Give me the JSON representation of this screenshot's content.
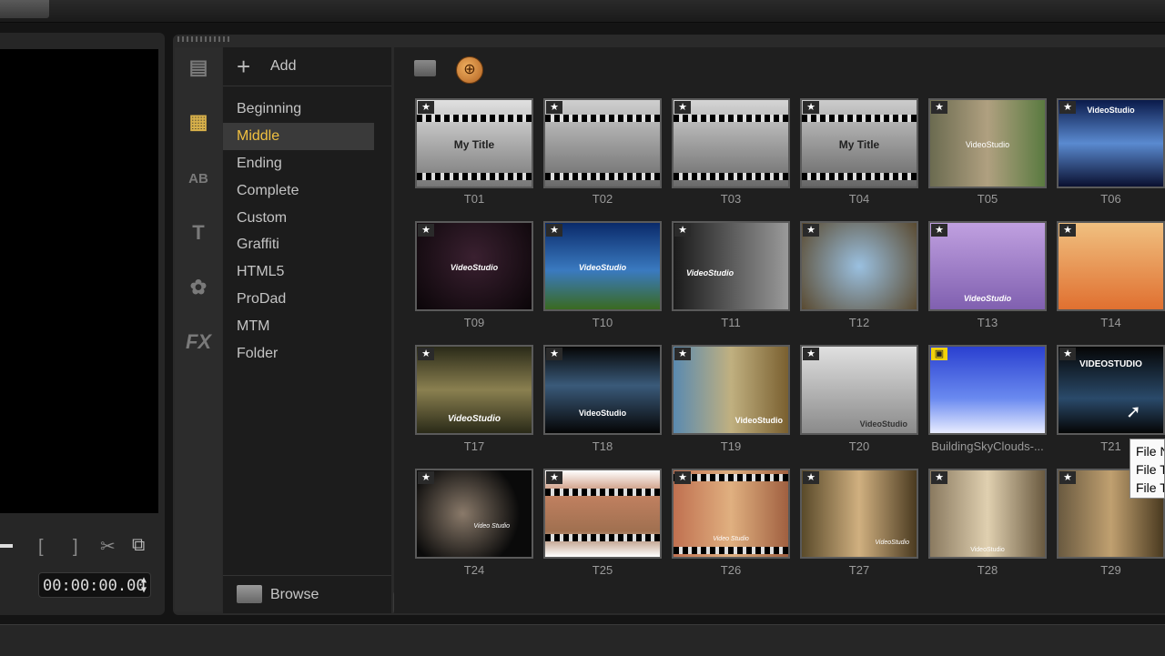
{
  "library": {
    "add_label": "Add",
    "browse_label": "Browse",
    "collapse_glyph": "«",
    "categories": [
      "Beginning",
      "Middle",
      "Ending",
      "Complete",
      "Custom",
      "Graffiti",
      "HTML5",
      "ProDad",
      "MTM",
      "Folder"
    ],
    "selected_category": "Middle",
    "side_icons": [
      "media-icon",
      "instant-project-icon",
      "transition-icon",
      "title-icon",
      "graphic-icon",
      "filter-icon"
    ],
    "side_icon_labels": {
      "transition": "AB",
      "title": "T",
      "filter": "FX"
    }
  },
  "player": {
    "timecode": "00:00:00.00",
    "bracket_in": "[",
    "bracket_out": "]"
  },
  "thumbnails": [
    {
      "caption": "T01",
      "overlay": "My Title"
    },
    {
      "caption": "T02",
      "overlay": ""
    },
    {
      "caption": "T03",
      "overlay": ""
    },
    {
      "caption": "T04",
      "overlay": "My Title"
    },
    {
      "caption": "T05",
      "overlay": "VideoStudio"
    },
    {
      "caption": "T06",
      "overlay": "VideoStudio"
    },
    {
      "caption": "T09",
      "overlay": "VideoStudio"
    },
    {
      "caption": "T10",
      "overlay": "VideoStudio"
    },
    {
      "caption": "T11",
      "overlay": "VideoStudio"
    },
    {
      "caption": "T12",
      "overlay": ""
    },
    {
      "caption": "T13",
      "overlay": "VideoStudio"
    },
    {
      "caption": "T14",
      "overlay": ""
    },
    {
      "caption": "T17",
      "overlay": "VideoStudio"
    },
    {
      "caption": "T18",
      "overlay": "VideoStudio"
    },
    {
      "caption": "T19",
      "overlay": "VideoStudio"
    },
    {
      "caption": "T20",
      "overlay": "VideoStudio"
    },
    {
      "caption": "BuildingSkyClouds-...",
      "overlay": ""
    },
    {
      "caption": "T21",
      "overlay": "VIDEOSTUDIO"
    },
    {
      "caption": "T24",
      "overlay": "Video Studio"
    },
    {
      "caption": "T25",
      "overlay": ""
    },
    {
      "caption": "T26",
      "overlay": "Video Studio"
    },
    {
      "caption": "T27",
      "overlay": "VideoStudio"
    },
    {
      "caption": "T28",
      "overlay": "VideoStudio"
    },
    {
      "caption": "T29",
      "overlay": ""
    }
  ],
  "tooltip": {
    "lines": [
      "File N",
      "File T",
      "File T"
    ]
  },
  "colors": {
    "accent": "#f0c040",
    "selected_bg": "#3a3a3a"
  }
}
